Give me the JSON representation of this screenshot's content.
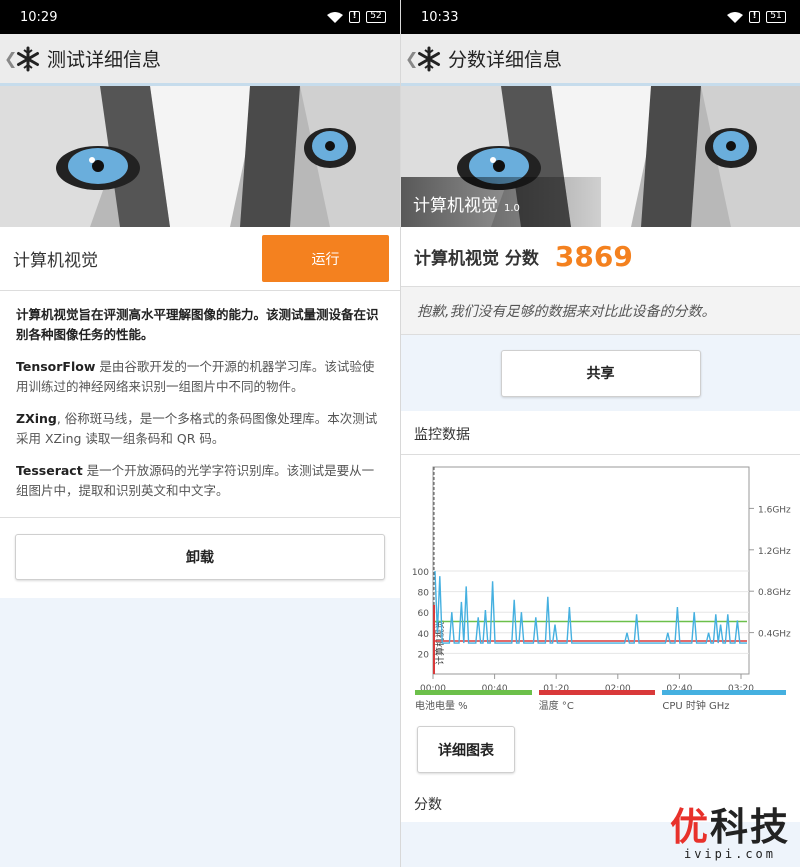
{
  "left": {
    "status_time": "10:29",
    "battery": "52",
    "title": "测试详细信息",
    "test_name": "计算机视觉",
    "run_label": "运行",
    "desc_lead": "计算机视觉旨在评测高水平理解图像的能力。该测试量测设备在识别各种图像任务的性能。",
    "items": [
      {
        "name": "TensorFlow",
        "text": " 是由谷歌开发的一个开源的机器学习库。该试验使用训练过的神经网络来识别一组图片中不同的物件。"
      },
      {
        "name": "ZXing",
        "text": ", 俗称斑马线，是一个多格式的条码图像处理库。本次测试采用 XZing 读取一组条码和 QR 码。"
      },
      {
        "name": "Tesseract",
        "text": " 是一个开放源码的光学字符识别库。该测试是要从一组图片中，提取和识别英文和中文字。"
      }
    ],
    "uninstall_label": "卸载"
  },
  "right": {
    "status_time": "10:33",
    "battery": "51",
    "title": "分数详细信息",
    "hero_label": "计算机视觉",
    "hero_version": "1.0",
    "score_name": "计算机视觉 分数",
    "score_value": "3869",
    "sorry_text": "抱歉,我们没有足够的数据来对比此设备的分数。",
    "share_label": "共享",
    "monitor_title": "监控数据",
    "legend": [
      "电池电量 %",
      "温度 °C",
      "CPU 时钟 GHz"
    ],
    "detail_label": "详细图表",
    "score_section": "分数"
  },
  "colors": {
    "accent": "#f4811f",
    "battery": "#6cc04a",
    "temp": "#d9393a",
    "cpu": "#45b0e0"
  },
  "chart_data": {
    "type": "line",
    "x": [
      "00:00",
      "00:40",
      "01:20",
      "02:00",
      "02:40",
      "03:20"
    ],
    "ylim": [
      0,
      100
    ],
    "y_ticks": [
      20,
      40,
      60,
      80,
      100
    ],
    "y2_ticks": [
      "0.4GHz",
      "0.8GHz",
      "1.2GHz",
      "1.6GHz"
    ],
    "marker_label": "计算机视觉",
    "series": [
      {
        "name": "电池电量 %",
        "values": [
          51,
          51
        ]
      },
      {
        "name": "温度 °C",
        "values": [
          32,
          32
        ]
      },
      {
        "name": "CPU 时钟 GHz",
        "values": [
          100,
          40,
          95,
          30,
          30,
          30,
          30,
          60,
          30,
          30,
          30,
          70,
          30,
          85,
          30,
          30,
          30,
          30,
          55,
          30,
          30,
          62,
          30,
          30,
          90,
          30,
          30,
          30,
          30,
          30,
          30,
          30,
          30,
          72,
          30,
          30,
          60,
          30,
          30,
          30,
          30,
          30,
          55,
          30,
          30,
          30,
          30,
          75,
          30,
          30,
          48,
          30,
          30,
          30,
          30,
          30,
          65,
          30,
          30,
          30,
          30,
          30,
          30,
          30,
          30,
          30,
          30,
          30,
          30,
          30,
          30,
          30,
          30,
          30,
          30,
          30,
          30,
          30,
          30,
          30,
          40,
          30,
          30,
          30,
          58,
          30,
          30,
          30,
          30,
          30,
          30,
          30,
          30,
          30,
          30,
          30,
          30,
          40,
          30,
          30,
          30,
          65,
          30,
          30,
          30,
          30,
          30,
          30,
          60,
          30,
          30,
          30,
          30,
          30,
          40,
          30,
          30,
          58,
          30,
          48,
          30,
          30,
          58,
          30,
          30,
          30,
          52,
          30,
          30,
          30,
          30
        ]
      }
    ]
  }
}
